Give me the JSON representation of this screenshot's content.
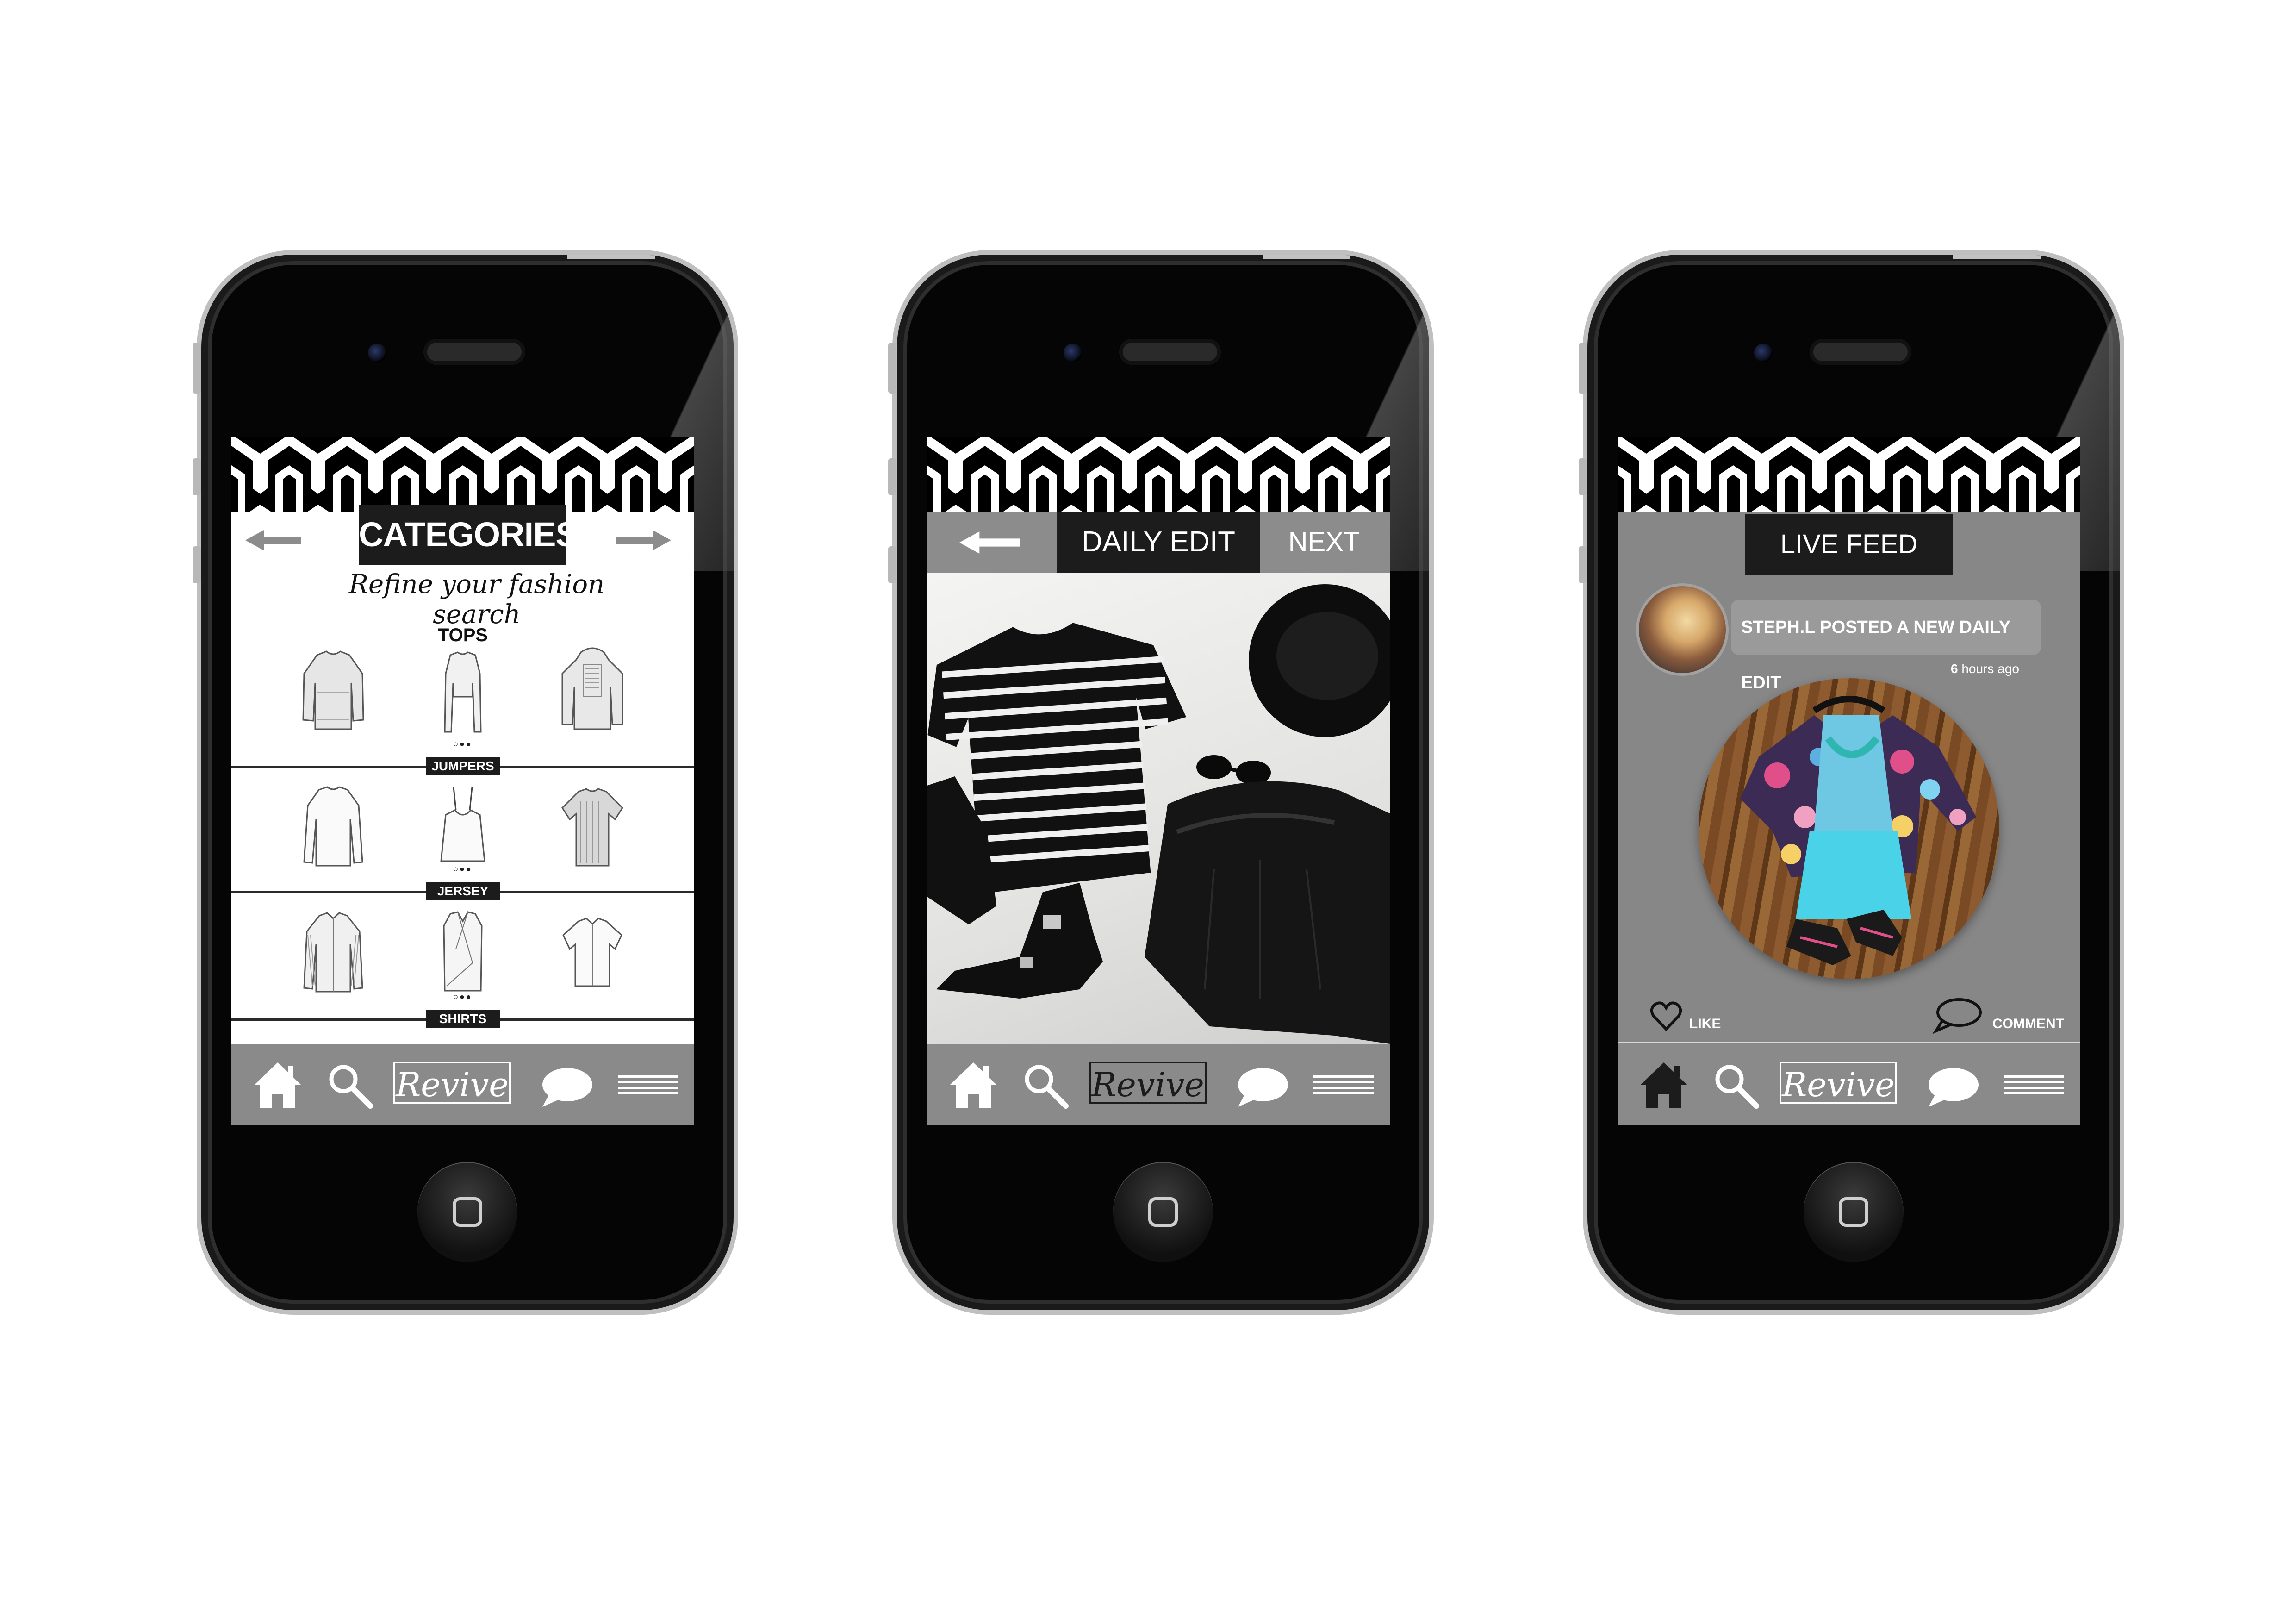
{
  "screens": {
    "categories": {
      "title": "CATEGORIES",
      "tagline": "Refine your fashion search",
      "sections": [
        {
          "heading": "TOPS",
          "label": "JUMPERS"
        },
        {
          "heading": "",
          "label": "JERSEY"
        },
        {
          "heading": "",
          "label": "SHIRTS"
        }
      ],
      "page_dots": "○●●"
    },
    "daily_edit": {
      "title": "DAILY EDIT",
      "next_label": "NEXT"
    },
    "live_feed": {
      "title": "LIVE FEED",
      "post_text": "STEPH.L POSTED A NEW DAILY EDIT",
      "time_number": "6",
      "time_unit": "hours ago",
      "like_label": "LIKE",
      "comment_label": "COMMENT"
    }
  },
  "tabbar": {
    "logo_text": "Revive",
    "icons": [
      "home-icon",
      "search-icon",
      "chat-icon",
      "menu-icon"
    ]
  },
  "colors": {
    "header_box": "#1c1c1c",
    "tabbar": "#8a8a8a",
    "feed_background": "#878787"
  }
}
